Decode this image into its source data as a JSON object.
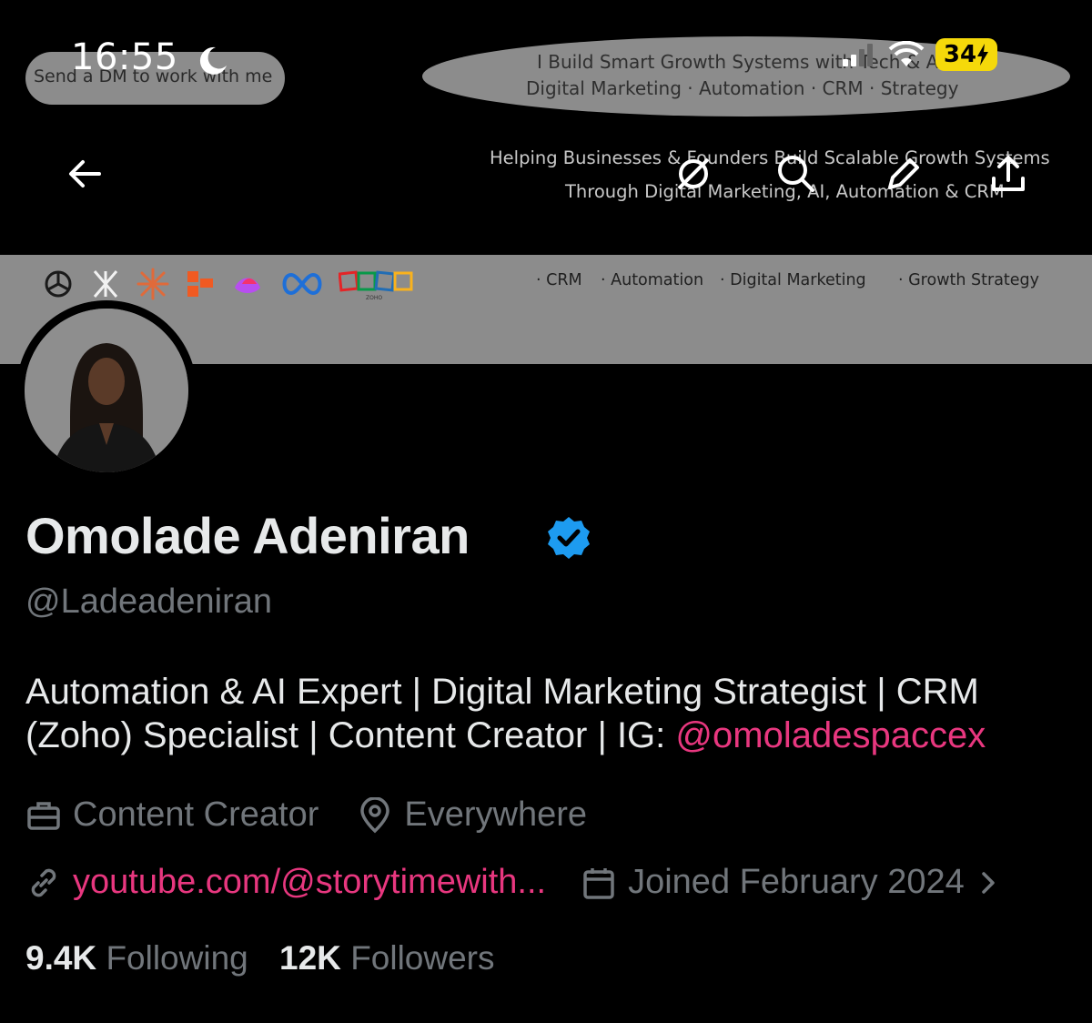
{
  "status_bar": {
    "time": "16:55",
    "battery": "34"
  },
  "banner": {
    "dm_pill": "Send a DM to work with me",
    "tagline_line1": "I Build Smart Growth Systems with Tech & AI",
    "tagline_line2": "Digital Marketing · Automation · CRM · Strategy",
    "helping_line1": "Helping Businesses & Founders Build Scalable Growth Systems",
    "helping_line2": "Through Digital Marketing, AI, Automation & CRM",
    "band_tags": [
      "· CRM",
      "· Automation",
      "· Digital Marketing",
      "· Growth Strategy"
    ],
    "zoho_label": "ZOHO"
  },
  "nav": {
    "icons": [
      "back-arrow-icon",
      "grok-icon",
      "search-icon",
      "edit-pencil-icon",
      "share-upload-icon"
    ]
  },
  "profile": {
    "name": "Omolade Adeniran",
    "handle": "@Ladeadeniran",
    "bio_text": "Automation & AI Expert | Digital Marketing Strategist | CRM (Zoho) Specialist | Content Creator | IG: ",
    "bio_link": "@omoladespaccex",
    "category": "Content Creator",
    "location": "Everywhere",
    "website": "youtube.com/@storytimewith...",
    "joined": "Joined February 2024",
    "following_count": "9.4K",
    "following_label": "Following",
    "followers_count": "12K",
    "followers_label": "Followers"
  },
  "colors": {
    "accent_link": "#e8377f",
    "verified": "#1d9bf0",
    "muted": "#71767b"
  }
}
